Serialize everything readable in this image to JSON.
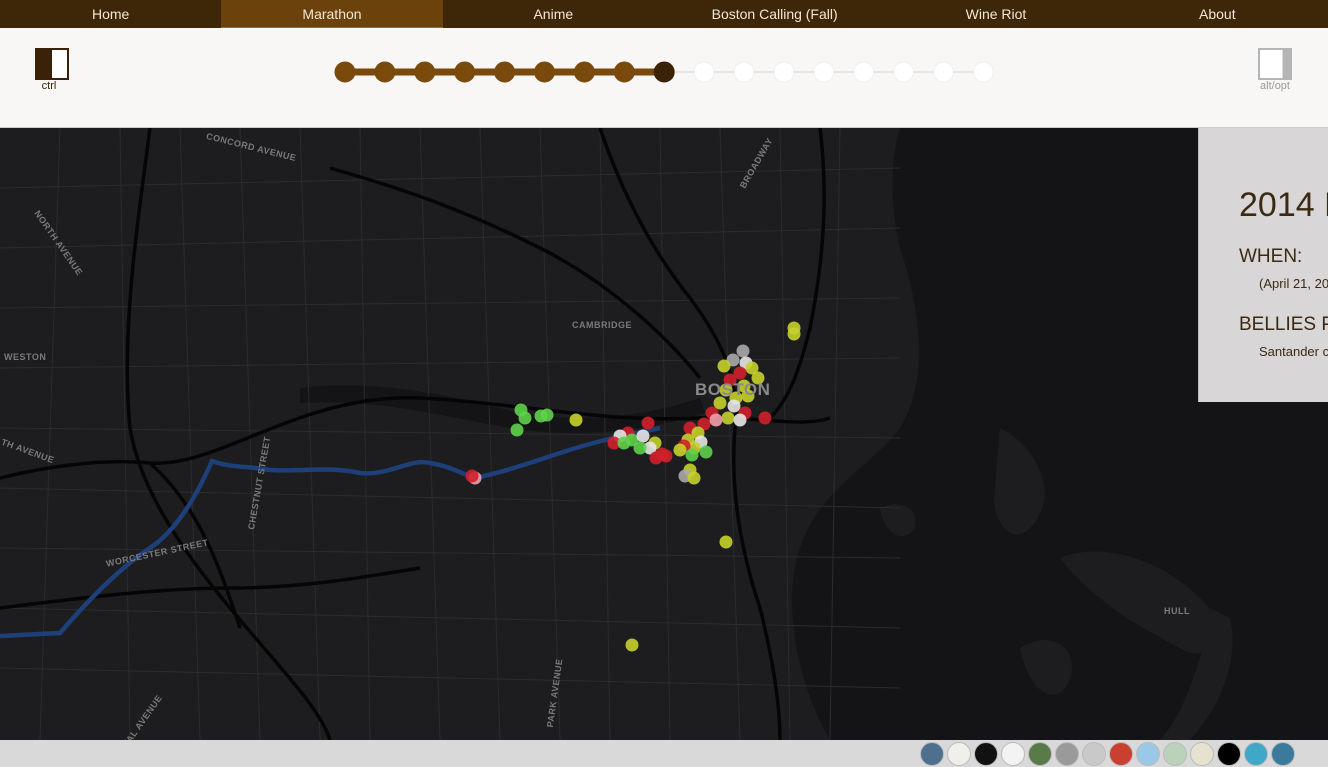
{
  "nav": {
    "items": [
      {
        "label": "Home",
        "active": false
      },
      {
        "label": "Marathon",
        "active": true
      },
      {
        "label": "Anime",
        "active": false
      },
      {
        "label": "Boston Calling (Fall)",
        "active": false
      },
      {
        "label": "Wine Riot",
        "active": false
      },
      {
        "label": "About",
        "active": false
      }
    ]
  },
  "controls": {
    "ctrl_label": "ctrl",
    "alt_label": "alt/opt"
  },
  "timeline": {
    "total_steps": 17,
    "completed_steps": 8,
    "current_step": 9,
    "completed_color": "#7a4a0c",
    "current_color": "#3a2208",
    "pending_color": "#ffffff"
  },
  "map": {
    "theme": "dark",
    "labels": {
      "concord": "CONCORD AVENUE",
      "north": "NORTH AVENUE",
      "weston": "WESTON",
      "cambridge": "CAMBRIDGE",
      "boston": "BOSTON",
      "broadway": "BROADWAY",
      "chestnut": "CHESTNUT STREET",
      "worcester": "WORCESTER STREET",
      "th_avenue": "TH AVENUE",
      "park_avenue": "PARK AVENUE",
      "hull": "HULL",
      "royal": "YAL AVENUE"
    },
    "route_color": "#1d3f7a",
    "point_colors": {
      "positive": "#5fd24a",
      "neutral": "#c6d22a",
      "negative": "#d0202a",
      "light": "#e7e7e7",
      "pink": "#f0a0a8",
      "gray": "#aaaaaa"
    }
  },
  "info_panel": {
    "title": "2014 B",
    "when_heading": "WHEN:",
    "when_value": "(April 21, 20",
    "bellies_heading": "BELLIES PI",
    "bellies_value": "Santander c"
  },
  "footer": {
    "swatches": [
      {
        "name": "blue-globe-swatch",
        "color": "#4f6f8f"
      },
      {
        "name": "light-swatch",
        "color": "#f1efea"
      },
      {
        "name": "dark-swatch",
        "color": "#111111"
      },
      {
        "name": "white-swatch",
        "color": "#f3f3f3"
      },
      {
        "name": "green-terrain-swatch",
        "color": "#5b7a4a"
      },
      {
        "name": "gray-swatch",
        "color": "#9a9a9a"
      },
      {
        "name": "light-gray-swatch",
        "color": "#c9c9c9"
      },
      {
        "name": "beige-red-swatch",
        "color": "#c94030"
      },
      {
        "name": "sky-blue-swatch",
        "color": "#9cc8e8"
      },
      {
        "name": "pale-green-swatch",
        "color": "#b9d2b9"
      },
      {
        "name": "cream-swatch",
        "color": "#e6e2d0"
      },
      {
        "name": "black-white-swatch",
        "color": "#000000"
      },
      {
        "name": "teal-swatch",
        "color": "#3fa8c8"
      },
      {
        "name": "blue-green-swatch",
        "color": "#3b7a9a"
      }
    ]
  }
}
